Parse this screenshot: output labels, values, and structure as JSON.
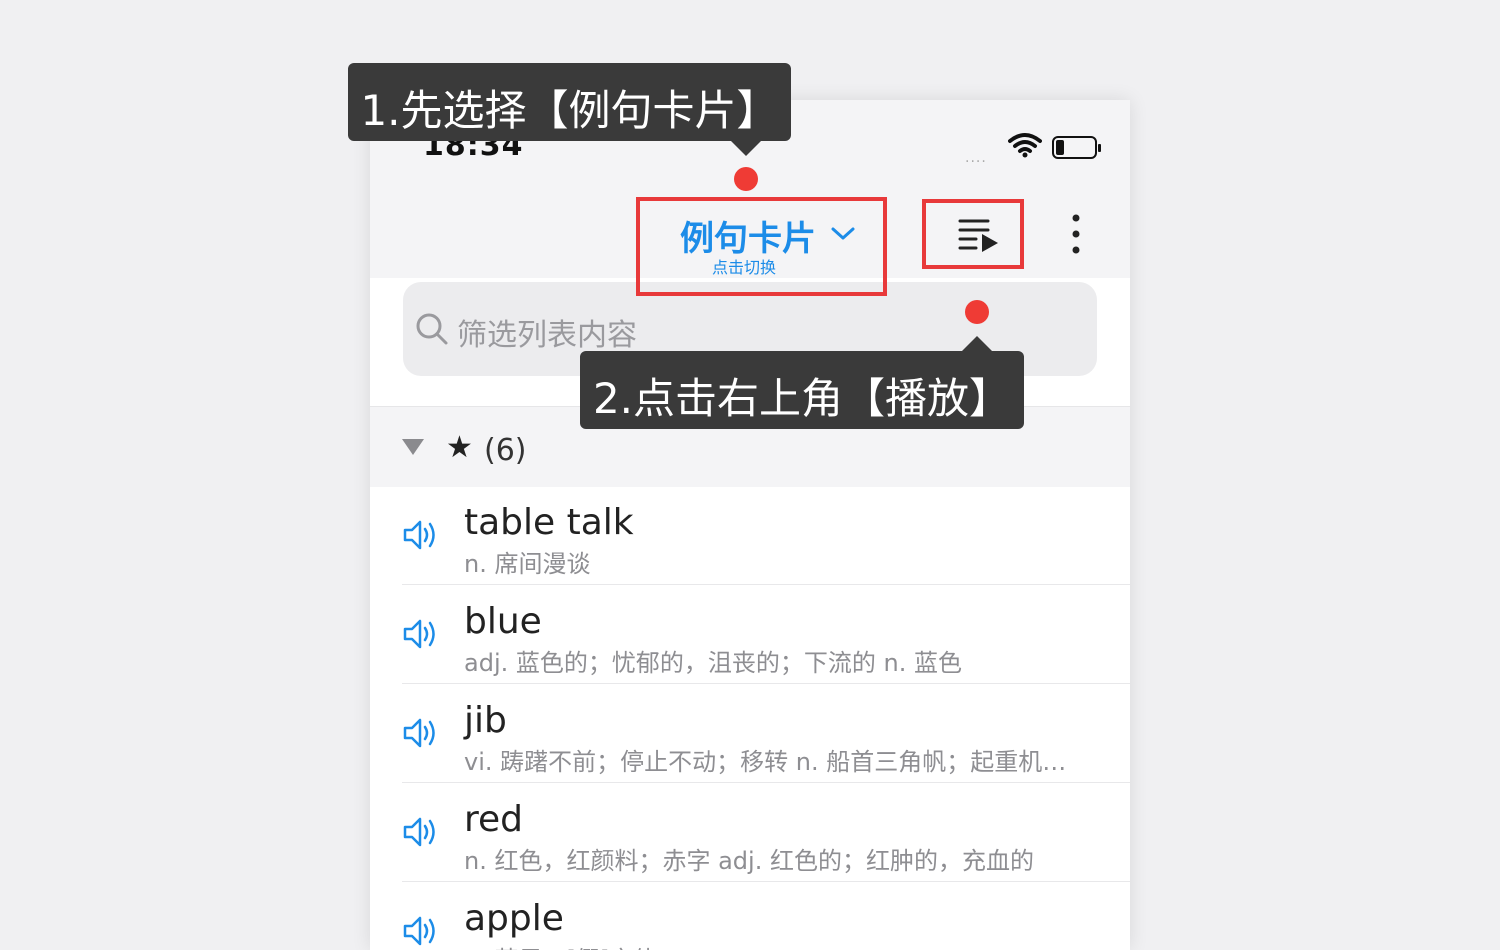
{
  "status_bar": {
    "time": "18:34",
    "signal": "....",
    "wifi_icon": "wifi-icon",
    "battery_icon": "battery-icon"
  },
  "header": {
    "title": "例句卡片",
    "subtitle": "点击切换",
    "dropdown_icon": "chevron-down-icon",
    "play_icon": "playlist-play-icon",
    "more_icon": "more-vertical-icon"
  },
  "search": {
    "placeholder": "筛选列表内容",
    "icon": "search-icon"
  },
  "group": {
    "icon": "star-icon",
    "count": "(6)"
  },
  "items": [
    {
      "word": "table talk",
      "definition": "n. 席间漫谈"
    },
    {
      "word": "blue",
      "definition": "adj. 蓝色的；忧郁的，沮丧的；下流的 n. 蓝色"
    },
    {
      "word": "jib",
      "definition": "vi. 踌躇不前；停止不动；移转 n. 船首三角帆；起重机…"
    },
    {
      "word": "red",
      "definition": "n. 红色，红颜料；赤字 adj. 红色的；红肿的，充血的"
    },
    {
      "word": "apple",
      "definition": "n. 苹果；[假]字体"
    }
  ],
  "annotations": {
    "step1": "1.先选择【例句卡片】",
    "step2": "2.点击右上角【播放】",
    "highlight_color": "#e8393a",
    "dot_color": "#ef3b35",
    "accent_color": "#1c8ce8"
  }
}
